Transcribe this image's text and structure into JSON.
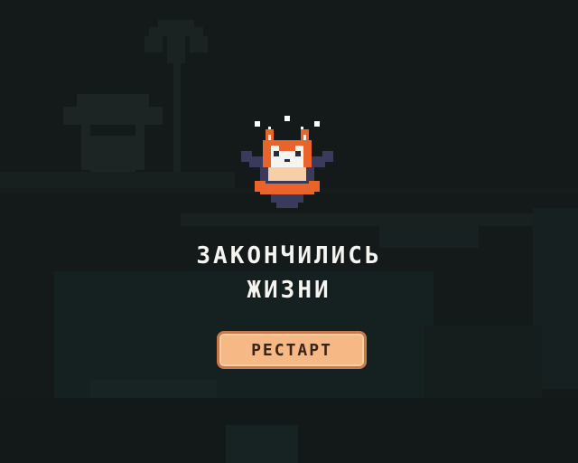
{
  "game_over": {
    "title_line1": "ЗАКОНЧИЛИСЬ",
    "title_line2": "ЖИЗНИ",
    "restart_label": "РЕСТАРТ"
  },
  "colors": {
    "overlay_bg": "#141a1a",
    "title_text": "#f4f4f0",
    "button_fill": "#f6b884",
    "button_border": "#c9784a",
    "button_text": "#3a2418",
    "fox_orange": "#e8642a",
    "fox_dark": "#3a3a5c"
  },
  "icons": {
    "mascot": "dazed-fox-icon"
  }
}
